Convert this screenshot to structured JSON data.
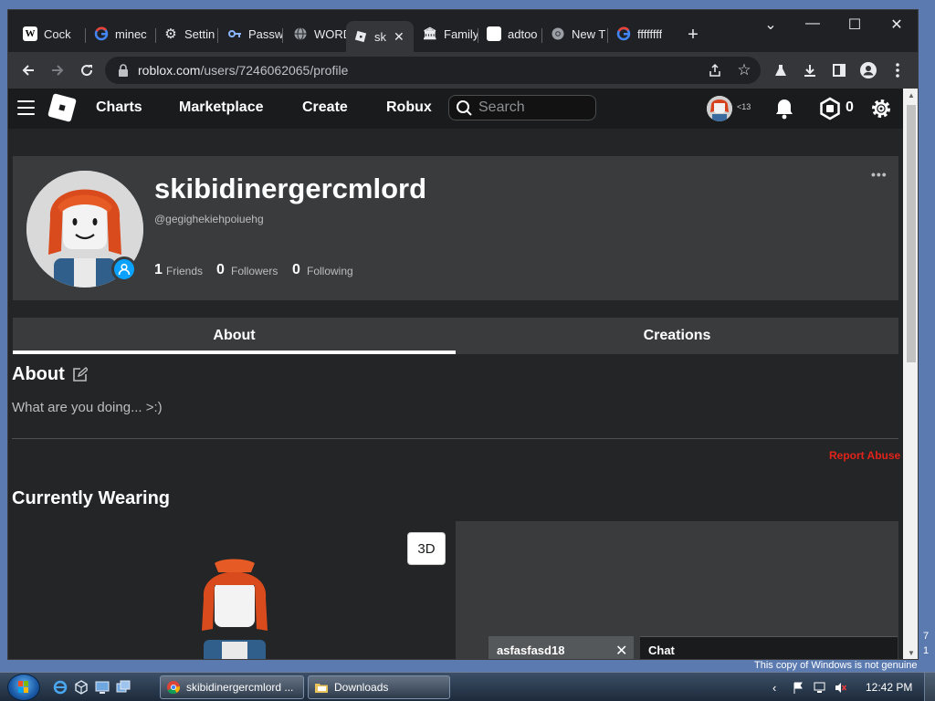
{
  "browser": {
    "tabs": [
      {
        "label": "Cock",
        "icon": "wikipedia-icon"
      },
      {
        "label": "minec",
        "icon": "google-icon"
      },
      {
        "label": "Settin",
        "icon": "gear-icon"
      },
      {
        "label": "Passw",
        "icon": "key-icon"
      },
      {
        "label": "WORD",
        "icon": "globe-icon"
      },
      {
        "label": "sk",
        "icon": "roblox-icon"
      },
      {
        "label": "Family",
        "icon": "building-icon"
      },
      {
        "label": "adtoo",
        "icon": "blank-page-icon"
      },
      {
        "label": "New T",
        "icon": "chrome-icon"
      },
      {
        "label": "ffffffff",
        "icon": "google-icon"
      }
    ],
    "url_host": "roblox.com",
    "url_path": "/users/7246062065/profile",
    "colors": {
      "frame": "#202124",
      "toolbar": "#35363a"
    }
  },
  "nav": {
    "links": [
      "Charts",
      "Marketplace",
      "Create",
      "Robux"
    ],
    "search_placeholder": "Search",
    "age_label": "<13",
    "robux_count": "0"
  },
  "profile": {
    "display_name": "skibidinergercmlord",
    "username": "@gegighekiehpoiuehg",
    "friends_count": "1",
    "friends_label": "Friends",
    "followers_count": "0",
    "followers_label": "Followers",
    "following_count": "0",
    "following_label": "Following",
    "more_label": "•••"
  },
  "tabs": {
    "about": "About",
    "creations": "Creations"
  },
  "about": {
    "heading": "About",
    "text": "What are you doing... >:)",
    "report": "Report Abuse"
  },
  "wearing": {
    "heading": "Currently Wearing",
    "btn_3d": "3D"
  },
  "chat": {
    "conversation": "asfasfasd18",
    "main": "Chat",
    "close": "✕"
  },
  "taskbar": {
    "windows": [
      "skibidinergercmlord ...",
      "Downloads"
    ],
    "clock": "12:42 PM"
  },
  "watermark": {
    "line": "This copy of Windows is not genuine",
    "digits": [
      "7",
      "1"
    ]
  }
}
